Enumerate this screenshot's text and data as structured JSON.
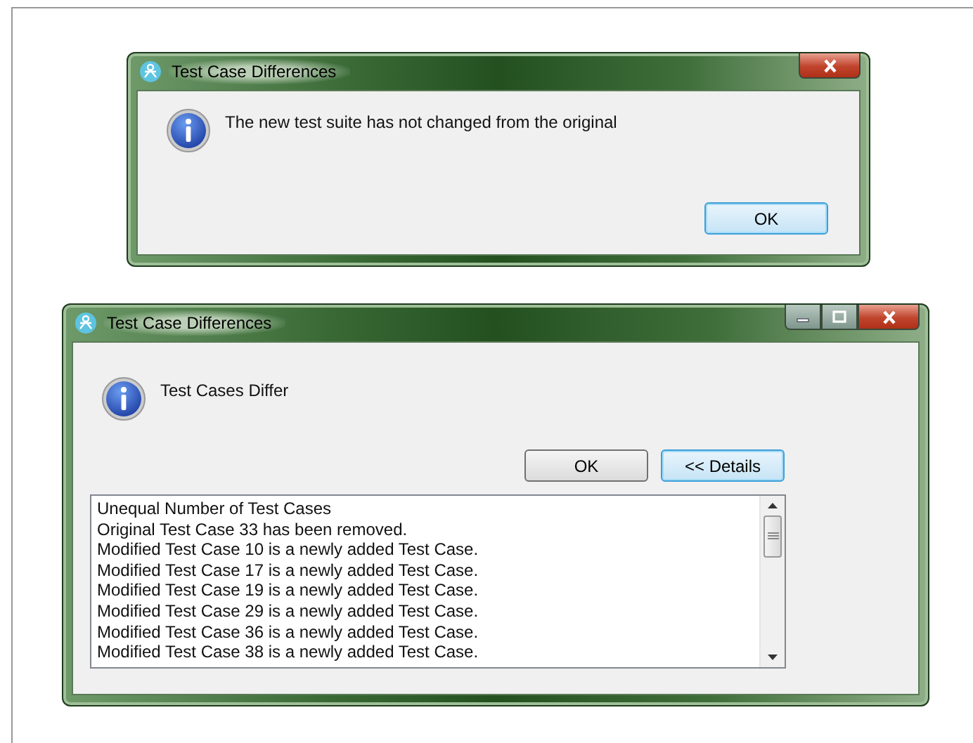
{
  "dialogs": [
    {
      "title": "Test Case Differences",
      "window_controls": [
        {
          "kind": "close"
        }
      ],
      "message": "The new test suite has not changed from the original",
      "buttons": [
        {
          "label": "OK",
          "default": true
        }
      ]
    },
    {
      "title": "Test Case Differences",
      "window_controls": [
        {
          "kind": "minimize"
        },
        {
          "kind": "maximize"
        },
        {
          "kind": "close"
        }
      ],
      "message": "Test Cases Differ",
      "buttons": [
        {
          "label": "OK",
          "default": false
        },
        {
          "label": "<< Details",
          "default": true
        }
      ],
      "details": {
        "lines": [
          "Unequal Number of Test Cases",
          "Original Test Case 33 has been removed.",
          "Modified Test Case 10 is a newly added Test Case.",
          "Modified Test Case 17 is a newly added Test Case.",
          "Modified Test Case 19 is a newly added Test Case.",
          "Modified Test Case 29 is a newly added Test Case.",
          "Modified Test Case 36 is a newly added Test Case.",
          "Modified Test Case 38 is a newly added Test Case."
        ]
      }
    }
  ]
}
